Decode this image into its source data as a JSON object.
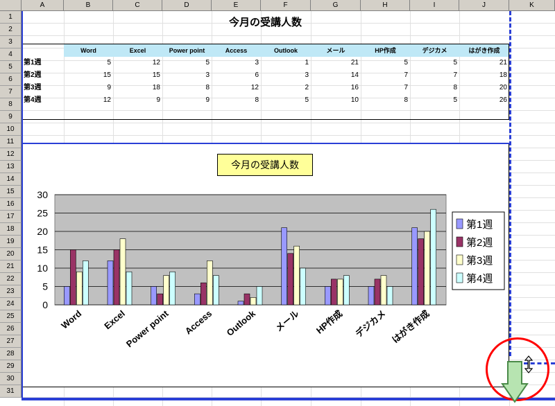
{
  "spreadsheet": {
    "columns": [
      "A",
      "B",
      "C",
      "D",
      "E",
      "F",
      "G",
      "H",
      "I",
      "J",
      "K"
    ],
    "rows": [
      "1",
      "2",
      "3",
      "4",
      "5",
      "6",
      "7",
      "8",
      "9",
      "10",
      "11",
      "12",
      "13",
      "14",
      "15",
      "16",
      "17",
      "18",
      "19",
      "20",
      "21",
      "22",
      "23",
      "24",
      "25",
      "26",
      "27",
      "28",
      "29",
      "30",
      "31"
    ]
  },
  "table": {
    "title": "今月の受講人数",
    "headers": [
      "Word",
      "Excel",
      "Power point",
      "Access",
      "Outlook",
      "メール",
      "HP作成",
      "デジカメ",
      "はがき作成"
    ],
    "rows": [
      {
        "label": "第1週",
        "values": [
          "5",
          "12",
          "5",
          "3",
          "1",
          "21",
          "5",
          "5",
          "21"
        ]
      },
      {
        "label": "第2週",
        "values": [
          "15",
          "15",
          "3",
          "6",
          "3",
          "14",
          "7",
          "7",
          "18"
        ]
      },
      {
        "label": "第3週",
        "values": [
          "9",
          "18",
          "8",
          "12",
          "2",
          "16",
          "7",
          "8",
          "20"
        ]
      },
      {
        "label": "第4週",
        "values": [
          "12",
          "9",
          "9",
          "8",
          "5",
          "10",
          "8",
          "5",
          "26"
        ]
      }
    ]
  },
  "chart_data": {
    "type": "bar",
    "title": "今月の受講人数",
    "categories": [
      "Word",
      "Excel",
      "Power point",
      "Access",
      "Outlook",
      "メール",
      "HP作成",
      "デジカメ",
      "はがき作成"
    ],
    "series": [
      {
        "name": "第1週",
        "color": "#9999ff",
        "values": [
          5,
          12,
          5,
          3,
          1,
          21,
          5,
          5,
          21
        ]
      },
      {
        "name": "第2週",
        "color": "#993366",
        "values": [
          15,
          15,
          3,
          6,
          3,
          14,
          7,
          7,
          18
        ]
      },
      {
        "name": "第3週",
        "color": "#ffffcc",
        "values": [
          9,
          18,
          8,
          12,
          2,
          16,
          7,
          8,
          20
        ]
      },
      {
        "name": "第4週",
        "color": "#ccffff",
        "values": [
          12,
          9,
          9,
          8,
          5,
          10,
          8,
          5,
          26
        ]
      }
    ],
    "yticks": [
      "0",
      "5",
      "10",
      "15",
      "20",
      "25",
      "30"
    ],
    "ylim": [
      0,
      30
    ],
    "grid": true,
    "legend": "right",
    "plot_background": "#c0c0c0"
  },
  "colors": {
    "selection_border": "#2a3fd6",
    "highlight_circle": "#ff0000",
    "arrow_fill": "#b7e4b1"
  },
  "icons": {
    "resize_cursor": "vertical-resize-icon",
    "arrow": "down-arrow-icon"
  }
}
